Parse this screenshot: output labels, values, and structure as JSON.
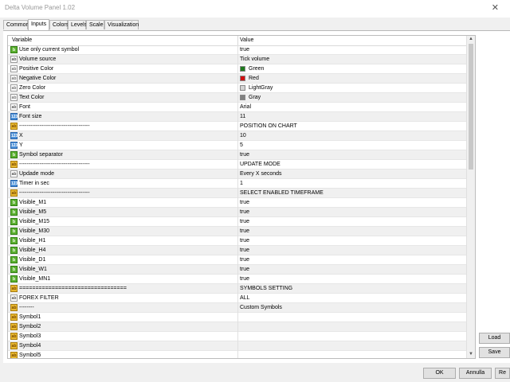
{
  "window": {
    "title": "Delta Volume Panel 1.02",
    "close_glyph": "✕"
  },
  "tabs": [
    {
      "label": "Common",
      "active": false
    },
    {
      "label": "Inputs",
      "active": true
    },
    {
      "label": "Colors",
      "active": false
    },
    {
      "label": "Levels",
      "active": false
    },
    {
      "label": "Scale",
      "active": false
    },
    {
      "label": "Visualization",
      "active": false
    }
  ],
  "grid": {
    "col_variable": "Variable",
    "col_value": "Value",
    "rows": [
      {
        "icon": "bool",
        "name": "Use only current symbol",
        "value": "true"
      },
      {
        "icon": "str",
        "name": "Volume source",
        "value": "Tick volume"
      },
      {
        "icon": "clr",
        "name": "Positive Color",
        "value": "Green",
        "swatch": "#1e7a1e"
      },
      {
        "icon": "clr",
        "name": "Negative Color",
        "value": "Red",
        "swatch": "#d01010"
      },
      {
        "icon": "clr",
        "name": "Zero Color",
        "value": "LightGray",
        "swatch": "#d3d3d3"
      },
      {
        "icon": "clr",
        "name": "Text Color",
        "value": "Gray",
        "swatch": "#808080"
      },
      {
        "icon": "str",
        "name": "Font",
        "value": "Arial"
      },
      {
        "icon": "num",
        "name": "Font size",
        "value": "11"
      },
      {
        "icon": "sep",
        "name": "--------------------------------------",
        "value": "POSITION ON CHART"
      },
      {
        "icon": "num",
        "name": "X",
        "value": "10"
      },
      {
        "icon": "num",
        "name": "Y",
        "value": "5"
      },
      {
        "icon": "bool",
        "name": "Symbol separator",
        "value": "true"
      },
      {
        "icon": "sep",
        "name": "--------------------------------------",
        "value": "UPDATE MODE"
      },
      {
        "icon": "str",
        "name": "Updade mode",
        "value": "Every X seconds"
      },
      {
        "icon": "num",
        "name": "Timer in sec",
        "value": "1"
      },
      {
        "icon": "sep",
        "name": "--------------------------------------",
        "value": "SELECT ENABLED TIMEFRAME"
      },
      {
        "icon": "bool",
        "name": "Visible_M1",
        "value": "true"
      },
      {
        "icon": "bool",
        "name": "Visible_M5",
        "value": "true"
      },
      {
        "icon": "bool",
        "name": "Visible_M15",
        "value": "true"
      },
      {
        "icon": "bool",
        "name": "Visible_M30",
        "value": "true"
      },
      {
        "icon": "bool",
        "name": "Visible_H1",
        "value": "true"
      },
      {
        "icon": "bool",
        "name": "Visible_H4",
        "value": "true"
      },
      {
        "icon": "bool",
        "name": "Visible_D1",
        "value": "true"
      },
      {
        "icon": "bool",
        "name": "Visible_W1",
        "value": "true"
      },
      {
        "icon": "bool",
        "name": "Visible_MN1",
        "value": "true"
      },
      {
        "icon": "sep",
        "name": "=================================",
        "value": "SYMBOLS SETTING"
      },
      {
        "icon": "str",
        "name": "FOREX FILTER",
        "value": "ALL"
      },
      {
        "icon": "sep",
        "name": "--------",
        "value": "Custom Symbols"
      },
      {
        "icon": "sep",
        "name": "Symbol1",
        "value": ""
      },
      {
        "icon": "sep",
        "name": "Symbol2",
        "value": ""
      },
      {
        "icon": "sep",
        "name": "Symbol3",
        "value": ""
      },
      {
        "icon": "sep",
        "name": "Symbol4",
        "value": ""
      },
      {
        "icon": "sep",
        "name": "Symbol5",
        "value": ""
      }
    ]
  },
  "side_buttons": {
    "load": "Load",
    "save": "Save"
  },
  "bottom_buttons": {
    "ok": "OK",
    "cancel": "Annulla",
    "reset": "Re"
  },
  "scroll_glyphs": {
    "up": "▲",
    "down": "▼"
  }
}
